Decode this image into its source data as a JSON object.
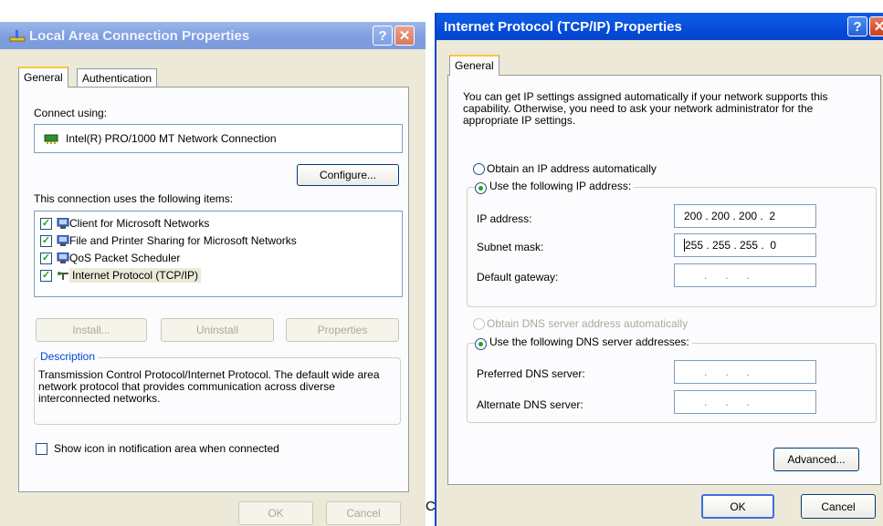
{
  "left_window": {
    "title": "Local Area Connection Properties",
    "tabs": [
      {
        "label": "General"
      },
      {
        "label": "Authentication"
      }
    ],
    "connect_using_label": "Connect using:",
    "adapter_name": "Intel(R) PRO/1000 MT Network Connection",
    "configure_label": "Configure...",
    "items_label": "This connection uses the following items:",
    "items": [
      {
        "label": "Client for Microsoft Networks",
        "checked": true,
        "icon": "network-client-icon"
      },
      {
        "label": "File and Printer Sharing for Microsoft Networks",
        "checked": true,
        "icon": "file-sharing-icon"
      },
      {
        "label": "QoS Packet Scheduler",
        "checked": true,
        "icon": "qos-scheduler-icon"
      },
      {
        "label": "Internet Protocol (TCP/IP)",
        "checked": true,
        "icon": "protocol-icon"
      }
    ],
    "install_label": "Install...",
    "uninstall_label": "Uninstall",
    "properties_label": "Properties",
    "description_label": "Description",
    "description_text": "Transmission Control Protocol/Internet Protocol. The default wide area network protocol that provides communication across diverse interconnected networks.",
    "show_icon_label": "Show icon in notification area when connected",
    "show_icon_checked": false,
    "ok_label": "OK",
    "cancel_label": "Cancel",
    "partial_letter": "C"
  },
  "right_window": {
    "title": "Internet Protocol (TCP/IP) Properties",
    "tab_general": "General",
    "intro_text": "You can get IP settings assigned automatically if your network supports this capability. Otherwise, you need to ask your network administrator for the appropriate IP settings.",
    "obtain_ip_label": "Obtain an IP address automatically",
    "use_ip_label": "Use the following IP address:",
    "ip_address_label": "IP address:",
    "ip_address_value": "200 . 200 . 200 .  2",
    "subnet_label": "Subnet mask:",
    "subnet_value": "255 . 255 . 255 .  0",
    "gateway_label": "Default gateway:",
    "gateway_value": ".      .      .",
    "obtain_dns_label": "Obtain DNS server address automatically",
    "use_dns_label": "Use the following DNS server addresses:",
    "preferred_dns_label": "Preferred DNS server:",
    "preferred_dns_value": ".      .      .",
    "alternate_dns_label": "Alternate DNS server:",
    "alternate_dns_value": ".      .      .",
    "advanced_label": "Advanced...",
    "ok_label": "OK",
    "cancel_label": "Cancel",
    "help_glyph": "?",
    "close_glyph": "✕"
  },
  "colors": {
    "title_active": "#0b57e0",
    "title_inactive": "#7e9ee0",
    "dialog_bg": "#ece9d8",
    "check_green": "#21a121"
  }
}
